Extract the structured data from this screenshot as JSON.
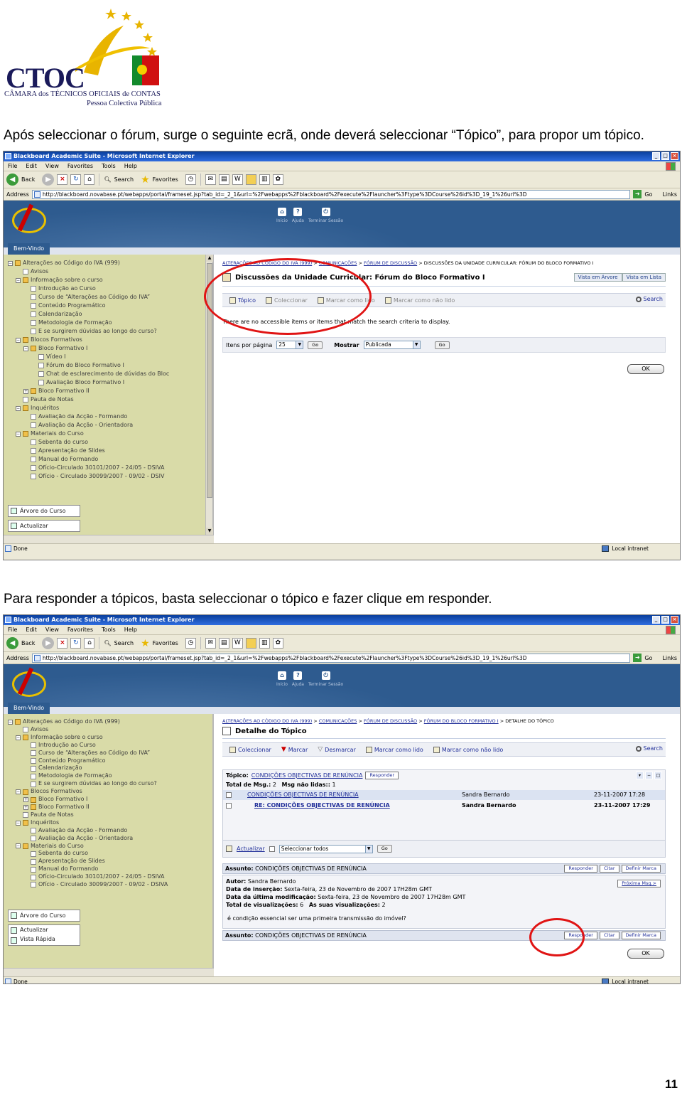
{
  "logo": {
    "text": "CTOC",
    "subtitle_line1": "CÂMARA dos TÉCNICOS OFICIAIS de CONTAS",
    "subtitle_line2": "Pessoa Colectiva Pública"
  },
  "paragraph1": "Após seleccionar o fórum, surge o seguinte ecrã, onde deverá seleccionar “Tópico”, para propor um tópico.",
  "paragraph2": "Para responder a tópicos, basta seleccionar o tópico e fazer clique em responder.",
  "page_number": "11",
  "browser": {
    "window_title": "Blackboard Academic Suite - Microsoft Internet Explorer",
    "menu": [
      "File",
      "Edit",
      "View",
      "Favorites",
      "Tools",
      "Help"
    ],
    "back_label": "Back",
    "search_label": "Search",
    "favorites_label": "Favorites",
    "address_label": "Address",
    "url": "http://blackboard.novabase.pt/webapps/portal/frameset.jsp?tab_id=_2_1&url=%2Fwebapps%2Fblackboard%2Fexecute%2Flauncher%3Ftype%3DCourse%26id%3D_19_1%26url%3D",
    "go_label": "Go",
    "links_label": "Links",
    "status_done": "Done",
    "status_zone": "Local intranet",
    "win_buttons": [
      "_",
      "□",
      "×"
    ]
  },
  "portal": {
    "tab": "Bem-Vindo",
    "nav": [
      {
        "icon": "⌂",
        "label": "Início"
      },
      {
        "icon": "?",
        "label": "Ajuda"
      },
      {
        "icon": "⏻",
        "label": "Terminar Sessão"
      }
    ]
  },
  "tree1": [
    {
      "label": "Alterações ao Código do IVA (999)",
      "indent": 0,
      "box": "−"
    },
    {
      "label": "Avisos",
      "indent": 1,
      "box": ""
    },
    {
      "label": "Informação sobre o curso",
      "indent": 1,
      "box": "−"
    },
    {
      "label": "Introdução ao Curso",
      "indent": 2,
      "box": ""
    },
    {
      "label": "Curso de “Alterações ao Código do IVA”",
      "indent": 2,
      "box": ""
    },
    {
      "label": "Conteúdo Programático",
      "indent": 2,
      "box": ""
    },
    {
      "label": "Calendarização",
      "indent": 2,
      "box": ""
    },
    {
      "label": "Metodologia de Formação",
      "indent": 2,
      "box": ""
    },
    {
      "label": "E se surgirem dúvidas ao longo do curso?",
      "indent": 2,
      "box": ""
    },
    {
      "label": "Blocos Formativos",
      "indent": 1,
      "box": "−"
    },
    {
      "label": "Bloco Formativo I",
      "indent": 2,
      "box": "−"
    },
    {
      "label": "Vídeo I",
      "indent": 3,
      "box": ""
    },
    {
      "label": "Fórum do Bloco Formativo I",
      "indent": 3,
      "box": ""
    },
    {
      "label": "Chat de esclarecimento de dúvidas do Bloc",
      "indent": 3,
      "box": ""
    },
    {
      "label": "Avaliação Bloco Formativo I",
      "indent": 3,
      "box": ""
    },
    {
      "label": "Bloco Formativo II",
      "indent": 2,
      "box": "+"
    },
    {
      "label": "Pauta de Notas",
      "indent": 1,
      "box": ""
    },
    {
      "label": "Inquéritos",
      "indent": 1,
      "box": "−"
    },
    {
      "label": "Avaliação da Acção - Formando",
      "indent": 2,
      "box": ""
    },
    {
      "label": "Avaliação da Acção - Orientadora",
      "indent": 2,
      "box": ""
    },
    {
      "label": "Materiais do Curso",
      "indent": 1,
      "box": "−"
    },
    {
      "label": "Sebenta do curso",
      "indent": 2,
      "box": ""
    },
    {
      "label": "Apresentação de Slides",
      "indent": 2,
      "box": ""
    },
    {
      "label": "Manual do Formando",
      "indent": 2,
      "box": ""
    },
    {
      "label": "Ofício-Circulado 30101/2007 - 24/05 - DSIVA",
      "indent": 2,
      "box": ""
    },
    {
      "label": "Ofício - Circulado 30099/2007 - 09/02 - DSIV",
      "indent": 2,
      "box": ""
    }
  ],
  "tree2": [
    {
      "label": "Alterações ao Código do IVA (999)",
      "indent": 0,
      "box": "−"
    },
    {
      "label": "Avisos",
      "indent": 1,
      "box": ""
    },
    {
      "label": "Informação sobre o curso",
      "indent": 1,
      "box": "−"
    },
    {
      "label": "Introdução ao Curso",
      "indent": 2,
      "box": ""
    },
    {
      "label": "Curso de “Alterações ao Código do IVA”",
      "indent": 2,
      "box": ""
    },
    {
      "label": "Conteúdo Programático",
      "indent": 2,
      "box": ""
    },
    {
      "label": "Calendarização",
      "indent": 2,
      "box": ""
    },
    {
      "label": "Metodologia de Formação",
      "indent": 2,
      "box": ""
    },
    {
      "label": "E se surgirem dúvidas ao longo do curso?",
      "indent": 2,
      "box": ""
    },
    {
      "label": "Blocos Formativos",
      "indent": 1,
      "box": "−"
    },
    {
      "label": "Bloco Formativo I",
      "indent": 2,
      "box": "+"
    },
    {
      "label": "Bloco Formativo II",
      "indent": 2,
      "box": "+"
    },
    {
      "label": "Pauta de Notas",
      "indent": 1,
      "box": ""
    },
    {
      "label": "Inquéritos",
      "indent": 1,
      "box": "−"
    },
    {
      "label": "Avaliação da Acção - Formando",
      "indent": 2,
      "box": ""
    },
    {
      "label": "Avaliação da Acção - Orientadora",
      "indent": 2,
      "box": ""
    },
    {
      "label": "Materiais do Curso",
      "indent": 1,
      "box": "−"
    },
    {
      "label": "Sebenta do curso",
      "indent": 2,
      "box": ""
    },
    {
      "label": "Apresentação de Slides",
      "indent": 2,
      "box": ""
    },
    {
      "label": "Manual do Formando",
      "indent": 2,
      "box": ""
    },
    {
      "label": "Ofício-Circulado 30101/2007 - 24/05 - DSIVA",
      "indent": 2,
      "box": ""
    },
    {
      "label": "Ofício - Circulado 30099/2007 - 09/02 - DSIVA",
      "indent": 2,
      "box": ""
    }
  ],
  "left_buttons": {
    "arvore": "Árvore do Curso",
    "actualizar": "Actualizar",
    "vista_rapida": "Vista Rápida"
  },
  "screen1": {
    "breadcrumb": [
      "ALTERAÇÕES AO CÓDIGO DO IVA (999)",
      "COMUNICAÇÕES",
      "FÓRUM DE DISCUSSÃO"
    ],
    "breadcrumb_current": "DISCUSSÕES DA UNIDADE CURRICULAR: FÓRUM DO BLOCO FORMATIVO I",
    "title": "Discussões da Unidade Curricular: Fórum do Bloco Formativo I",
    "view_tree": "Vista em Árvore",
    "view_list": "Vista em Lista",
    "actions": [
      {
        "label": "Tópico",
        "enabled": true
      },
      {
        "label": "Coleccionar",
        "enabled": false
      },
      {
        "label": "Marcar como lido",
        "enabled": false
      },
      {
        "label": "Marcar como não lido",
        "enabled": false
      }
    ],
    "search": "Search",
    "message": "There are no accessible items or items that match the search criteria to display.",
    "items_per_page_label": "Itens por página",
    "items_per_page_value": "25",
    "go": "Go",
    "show_label": "Mostrar",
    "show_value": "Publicada",
    "ok": "OK"
  },
  "screen2": {
    "breadcrumb": [
      "ALTERAÇÕES AO CÓDIGO DO IVA (999)",
      "COMUNICAÇÕES",
      "FÓRUM DE DISCUSSÃO",
      "FÓRUM DO BLOCO FORMATIVO I"
    ],
    "breadcrumb_current": "DETALHE DO TÓPICO",
    "title": "Detalhe do Tópico",
    "actions": [
      "Coleccionar",
      "Marcar",
      "Desmarcar",
      "Marcar como lido",
      "Marcar como não lido"
    ],
    "search": "Search",
    "topic_label": "Tópico:",
    "topic_value": "CONDIÇÕES OBJECTIVAS DE RENÚNCIA",
    "respond": "Responder",
    "total_label": "Total de Msg.:",
    "total_value": "2",
    "unread_label": "Msg não lidas::",
    "unread_value": "1",
    "threads": [
      {
        "subject": "CONDIÇÕES OBJECTIVAS DE RENÚNCIA",
        "author": "Sandra Bernardo",
        "date": "23-11-2007 17:28",
        "bold": false
      },
      {
        "subject": "RE: CONDIÇÕES OBJECTIVAS DE RENÚNCIA",
        "author": "Sandra Bernardo",
        "date": "23-11-2007 17:29",
        "bold": true
      }
    ],
    "refresh": "Actualizar",
    "select_all": "Seleccionar todos",
    "go": "Go",
    "subject_label": "Assunto:",
    "subject_value": "CONDIÇÕES OBJECTIVAS DE RENÚNCIA",
    "quote": "Citar",
    "set_mark": "Definir Marca",
    "next_msg": "Próxima Msg.>",
    "author_label": "Autor:",
    "author_value": "Sandra Bernardo",
    "insert_label": "Data de inserção:",
    "insert_value": "Sexta-feira, 23 de Novembro de 2007 17H28m GMT",
    "modified_label": "Data da última modificação:",
    "modified_value": "Sexta-feira, 23 de Novembro de 2007 17H28m GMT",
    "views_label": "Total de visualizações:",
    "views_value": "6",
    "your_views_label": "As suas visualizações:",
    "your_views_value": "2",
    "body": "é condição essencial ser uma primeira transmissão do imóvel?",
    "ok": "OK"
  },
  "colors": {
    "portal_blue": "#2e5b8f",
    "tree_bg": "#d9dba8",
    "link": "#22309a",
    "highlight_ring": "#e01414"
  }
}
